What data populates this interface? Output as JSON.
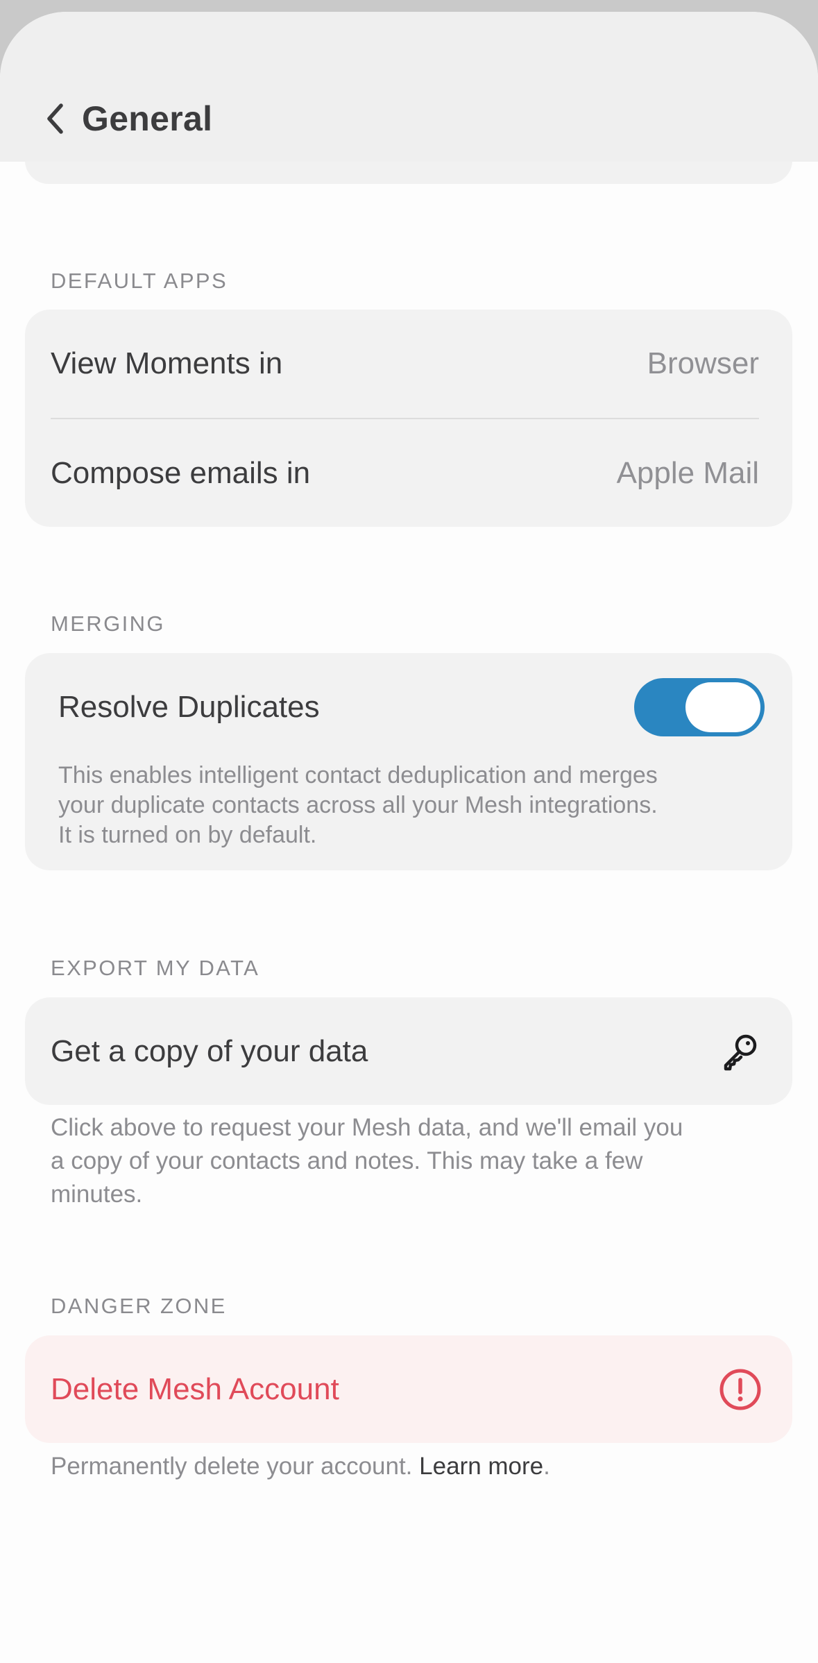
{
  "header": {
    "title": "General",
    "back_icon": "chevron-left-icon"
  },
  "default_apps": {
    "section_label": "DEFAULT APPS",
    "rows": [
      {
        "label": "View Moments in",
        "value": "Browser"
      },
      {
        "label": "Compose emails in",
        "value": "Apple Mail"
      }
    ]
  },
  "merging": {
    "section_label": "MERGING",
    "resolve_label": "Resolve Duplicates",
    "toggle_on": true,
    "toggle_color": "#2a86c1",
    "description_lines": [
      "This enables intelligent contact deduplication and merges",
      "your duplicate contacts across all your Mesh integrations.",
      "It is turned on by default."
    ]
  },
  "export": {
    "section_label": "EXPORT MY DATA",
    "row_label": "Get a copy of your data",
    "icon": "key-icon",
    "helper_lines": [
      "Click above to request your Mesh data, and we'll email you",
      "a copy of your contacts and notes. This may take a few",
      "minutes."
    ]
  },
  "danger": {
    "section_label": "DANGER ZONE",
    "row_label": "Delete Mesh Account",
    "icon": "alert-circle-icon",
    "accent_color": "#e04a59",
    "helper_text": "Permanently delete your account. ",
    "learn_more": "Learn more",
    "period": "."
  }
}
